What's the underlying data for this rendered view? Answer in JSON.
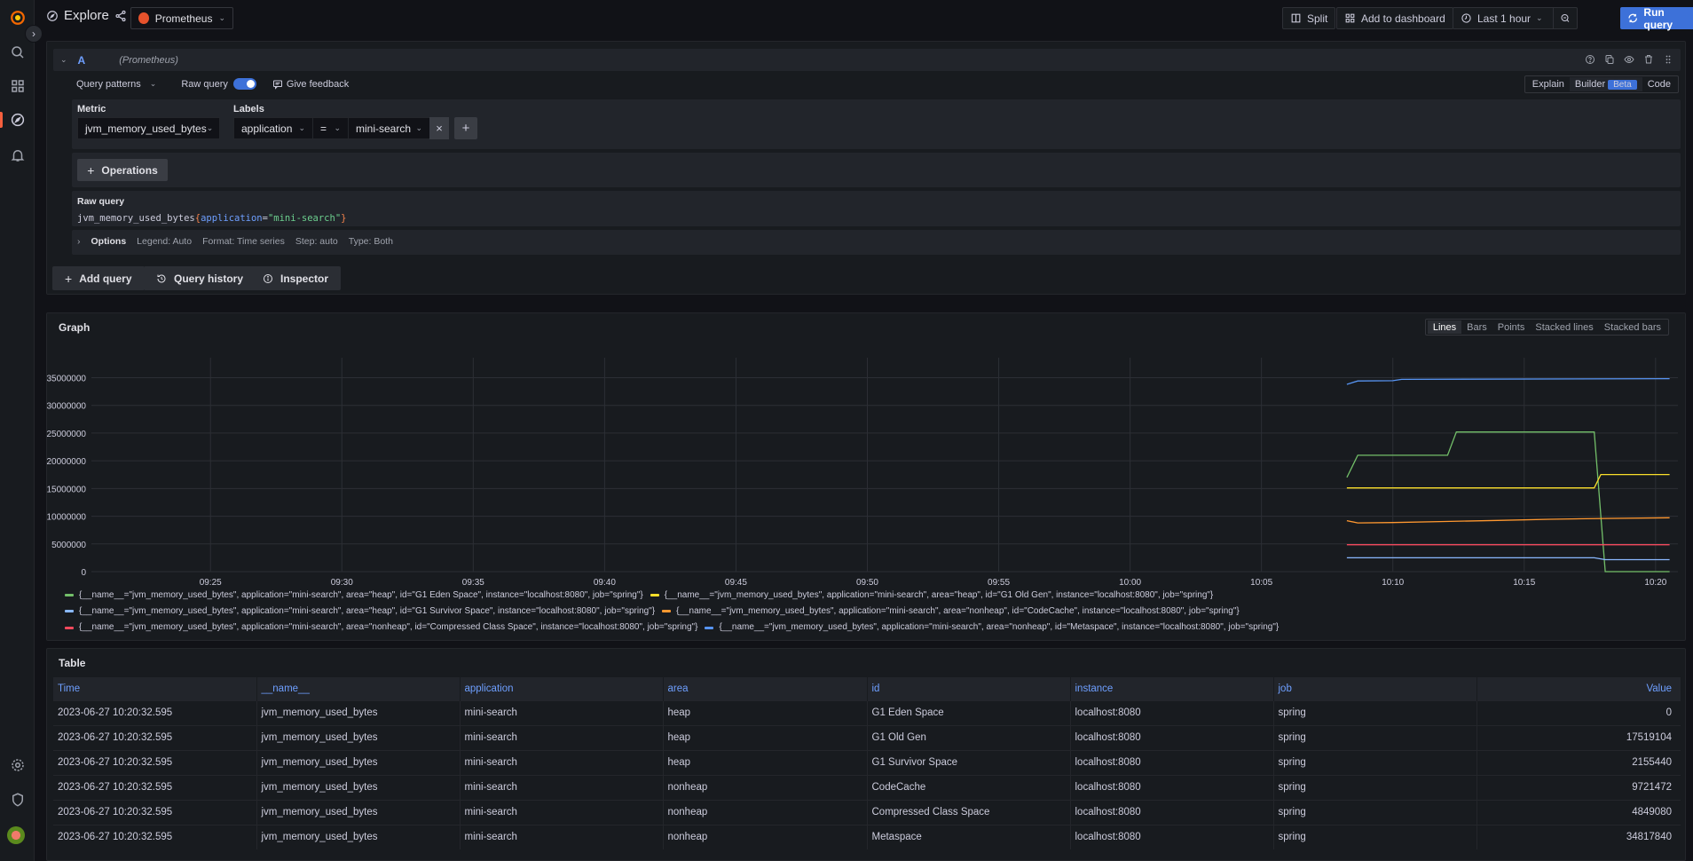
{
  "app": {
    "title": "Explore",
    "datasource": "Prometheus"
  },
  "sidebar": {
    "items": [
      {
        "name": "home",
        "icon": "grafana-logo"
      },
      {
        "name": "search",
        "icon": "search-icon"
      },
      {
        "name": "dashboards",
        "icon": "apps-icon"
      },
      {
        "name": "explore",
        "icon": "compass-icon",
        "active": true
      },
      {
        "name": "alerting",
        "icon": "bell-icon"
      },
      {
        "name": "configuration",
        "icon": "gear-icon"
      },
      {
        "name": "server-admin",
        "icon": "shield-icon"
      },
      {
        "name": "profile",
        "icon": "avatar"
      }
    ]
  },
  "toolbar": {
    "split_label": "Split",
    "add_to_dashboard_label": "Add to dashboard",
    "time_range_label": "Last 1 hour",
    "run_query_label": "Run query"
  },
  "query": {
    "ref_id": "A",
    "datasource_label": "(Prometheus)",
    "query_patterns_label": "Query patterns",
    "raw_query_toggle_label": "Raw query",
    "raw_query_enabled": true,
    "give_feedback_label": "Give feedback",
    "modes": [
      "Explain",
      "Builder",
      "Code"
    ],
    "active_mode": "Builder",
    "beta_badge": "Beta",
    "metric_label": "Metric",
    "metric_value": "jvm_memory_used_bytes",
    "labels_label": "Labels",
    "label_filter": {
      "key": "application",
      "op": "=",
      "value": "mini-search"
    },
    "operations_label": "Operations",
    "raw_query_title": "Raw query",
    "raw_query": {
      "metric": "jvm_memory_used_bytes",
      "open": "{",
      "label": "application",
      "eq": "=",
      "value": "\"mini-search\"",
      "close": "}"
    },
    "options": {
      "title": "Options",
      "legend": "Legend: Auto",
      "format": "Format: Time series",
      "step": "Step: auto",
      "type": "Type: Both"
    }
  },
  "actions": {
    "add_query_label": "Add query",
    "query_history_label": "Query history",
    "inspector_label": "Inspector"
  },
  "graph": {
    "title": "Graph",
    "types": [
      "Lines",
      "Bars",
      "Points",
      "Stacked lines",
      "Stacked bars"
    ],
    "active_type": "Lines"
  },
  "chart_data": {
    "type": "line",
    "title": "Graph",
    "xlabel": "",
    "ylabel": "",
    "x_ticks": [
      "09:25",
      "09:30",
      "09:35",
      "09:40",
      "09:45",
      "09:50",
      "09:55",
      "10:00",
      "10:05",
      "10:10",
      "10:15",
      "10:20"
    ],
    "x_range_minutes": [
      "09:21",
      "10:21"
    ],
    "y_ticks": [
      0,
      5000000,
      10000000,
      15000000,
      20000000,
      25000000,
      30000000,
      35000000
    ],
    "ylim": [
      0,
      37000000
    ],
    "grid": true,
    "legend_position": "bottom",
    "series": [
      {
        "name": "{__name__=\"jvm_memory_used_bytes\", application=\"mini-search\", area=\"heap\", id=\"G1 Eden Space\", instance=\"localhost:8080\", job=\"spring\"}",
        "color": "#73bf69",
        "points": [
          [
            "10:08:15",
            17000000
          ],
          [
            "10:08:40",
            21000000
          ],
          [
            "10:12:05",
            21000000
          ],
          [
            "10:12:25",
            25200000
          ],
          [
            "10:17:40",
            25200000
          ],
          [
            "10:18:05",
            0
          ],
          [
            "10:20:32",
            0
          ]
        ]
      },
      {
        "name": "{__name__=\"jvm_memory_used_bytes\", application=\"mini-search\", area=\"heap\", id=\"G1 Old Gen\", instance=\"localhost:8080\", job=\"spring\"}",
        "color": "#fade2a",
        "points": [
          [
            "10:08:15",
            15100000
          ],
          [
            "10:17:40",
            15100000
          ],
          [
            "10:17:55",
            17519104
          ],
          [
            "10:20:32",
            17519104
          ]
        ]
      },
      {
        "name": "{__name__=\"jvm_memory_used_bytes\", application=\"mini-search\", area=\"heap\", id=\"G1 Survivor Space\", instance=\"localhost:8080\", job=\"spring\"}",
        "color": "#8ab8ff",
        "points": [
          [
            "10:08:15",
            2500000
          ],
          [
            "10:17:40",
            2500000
          ],
          [
            "10:18:05",
            2155440
          ],
          [
            "10:20:32",
            2155440
          ]
        ]
      },
      {
        "name": "{__name__=\"jvm_memory_used_bytes\", application=\"mini-search\", area=\"nonheap\", id=\"CodeCache\", instance=\"localhost:8080\", job=\"spring\"}",
        "color": "#ff9830",
        "points": [
          [
            "10:08:15",
            9200000
          ],
          [
            "10:08:40",
            8800000
          ],
          [
            "10:10:00",
            8850000
          ],
          [
            "10:12:00",
            9050000
          ],
          [
            "10:14:00",
            9250000
          ],
          [
            "10:16:00",
            9450000
          ],
          [
            "10:18:00",
            9600000
          ],
          [
            "10:20:32",
            9721472
          ]
        ]
      },
      {
        "name": "{__name__=\"jvm_memory_used_bytes\", application=\"mini-search\", area=\"nonheap\", id=\"Compressed Class Space\", instance=\"localhost:8080\", job=\"spring\"}",
        "color": "#f2495c",
        "points": [
          [
            "10:08:15",
            4849080
          ],
          [
            "10:20:32",
            4849080
          ]
        ]
      },
      {
        "name": "{__name__=\"jvm_memory_used_bytes\", application=\"mini-search\", area=\"nonheap\", id=\"Metaspace\", instance=\"localhost:8080\", job=\"spring\"}",
        "color": "#5794f2",
        "points": [
          [
            "10:08:15",
            33800000
          ],
          [
            "10:08:40",
            34400000
          ],
          [
            "10:10:00",
            34450000
          ],
          [
            "10:10:20",
            34700000
          ],
          [
            "10:20:32",
            34817840
          ]
        ]
      }
    ]
  },
  "table": {
    "title": "Table",
    "columns": [
      "Time",
      "__name__",
      "application",
      "area",
      "id",
      "instance",
      "job",
      "Value"
    ],
    "rows": [
      [
        "2023-06-27 10:20:32.595",
        "jvm_memory_used_bytes",
        "mini-search",
        "heap",
        "G1 Eden Space",
        "localhost:8080",
        "spring",
        "0"
      ],
      [
        "2023-06-27 10:20:32.595",
        "jvm_memory_used_bytes",
        "mini-search",
        "heap",
        "G1 Old Gen",
        "localhost:8080",
        "spring",
        "17519104"
      ],
      [
        "2023-06-27 10:20:32.595",
        "jvm_memory_used_bytes",
        "mini-search",
        "heap",
        "G1 Survivor Space",
        "localhost:8080",
        "spring",
        "2155440"
      ],
      [
        "2023-06-27 10:20:32.595",
        "jvm_memory_used_bytes",
        "mini-search",
        "nonheap",
        "CodeCache",
        "localhost:8080",
        "spring",
        "9721472"
      ],
      [
        "2023-06-27 10:20:32.595",
        "jvm_memory_used_bytes",
        "mini-search",
        "nonheap",
        "Compressed Class Space",
        "localhost:8080",
        "spring",
        "4849080"
      ],
      [
        "2023-06-27 10:20:32.595",
        "jvm_memory_used_bytes",
        "mini-search",
        "nonheap",
        "Metaspace",
        "localhost:8080",
        "spring",
        "34817840"
      ]
    ]
  }
}
